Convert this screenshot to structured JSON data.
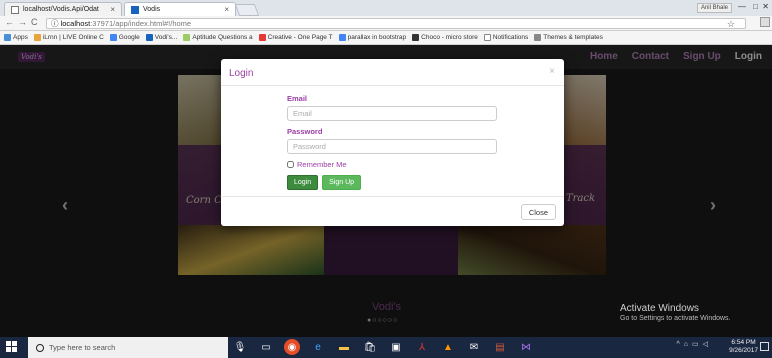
{
  "browser": {
    "tabs": [
      {
        "label": "localhost/Vodis.Api/Odat",
        "close": "×"
      },
      {
        "label": "Vodis",
        "close": "×"
      }
    ],
    "profile": "Anil Bhale",
    "url_host": "localhost",
    "url_path": ":37971/app/index.html#!/home",
    "bookmarks": [
      {
        "label": "Apps",
        "color": "#4a90d9"
      },
      {
        "label": "iLrnn | LIVE Online C",
        "color": "#e8a33b"
      },
      {
        "label": "Google",
        "color": "#4285f4"
      },
      {
        "label": "Vodi's...",
        "color": "#1565c0"
      },
      {
        "label": "Aptitude Questions a",
        "color": "#9ccc65"
      },
      {
        "label": "Creative - One Page T",
        "color": "#e53935"
      },
      {
        "label": "parallax in bootstrap",
        "color": "#4285f4"
      },
      {
        "label": "Choco - micro store",
        "color": "#333333"
      },
      {
        "label": "Notifications",
        "color": "#ffffff"
      },
      {
        "label": "Themes & templates",
        "color": "#888888"
      }
    ]
  },
  "site": {
    "logo": "Vodi's",
    "nav": [
      "Home",
      "Contact",
      "Sign Up",
      "Login"
    ],
    "slide_left_caption": "Corn C",
    "slide_right_caption": "Track",
    "prev": "‹",
    "next": "›",
    "brand_caption": "Vodi's",
    "dots": "●○○○○○"
  },
  "modal": {
    "title": "Login",
    "close_x": "×",
    "email_label": "Email",
    "email_placeholder": "Email",
    "password_label": "Password",
    "password_placeholder": "Password",
    "remember_label": "Remember Me",
    "login_button": "Login",
    "signup_button": "Sign Up",
    "close_button": "Close"
  },
  "windows": {
    "activate_title": "Activate Windows",
    "activate_sub": "Go to Settings to activate Windows.",
    "search_placeholder": "Type here to search",
    "time": "6:54 PM",
    "date": "9/26/2017"
  },
  "colors": {
    "accent": "#9b3ea5",
    "button_green": "#3d8b3d",
    "taskbar": "#1a2740"
  }
}
